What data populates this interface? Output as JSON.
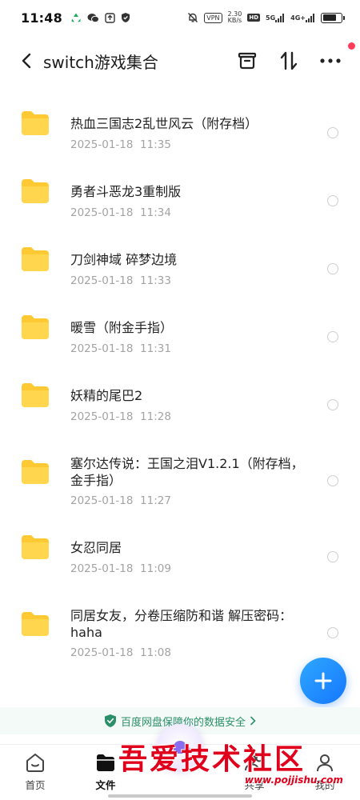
{
  "status_bar": {
    "time": "11:48",
    "vpn": "VPN",
    "speed_value": "2.30",
    "speed_unit": "KB/s",
    "hd": "HD",
    "net_5g": "5G",
    "net_4g": "4G+",
    "battery_level": 0.75
  },
  "header": {
    "title": "switch游戏集合"
  },
  "files": [
    {
      "name": "热血三国志2乱世风云（附存档）",
      "date": "2025-01-18  11:35"
    },
    {
      "name": "勇者斗恶龙3重制版",
      "date": "2025-01-18  11:34"
    },
    {
      "name": "刀剑神域 碎梦边境",
      "date": "2025-01-18  11:33"
    },
    {
      "name": "暖雪（附金手指）",
      "date": "2025-01-18  11:31"
    },
    {
      "name": "妖精的尾巴2",
      "date": "2025-01-18  11:28"
    },
    {
      "name": "塞尔达传说：王国之泪V1.2.1（附存档，金手指）",
      "date": "2025-01-18  11:27"
    },
    {
      "name": "女忍同居",
      "date": "2025-01-18  11:09"
    },
    {
      "name": "同居女友，分卷压缩防和谐 解压密码：haha",
      "date": "2025-01-18  11:08"
    }
  ],
  "security_banner": {
    "text": "百度网盘保障你的数据安全"
  },
  "bottom_nav": {
    "home": "首页",
    "files": "文件",
    "share": "共享",
    "mine": "我的"
  },
  "watermark": {
    "text": "吾爱技术社区",
    "url": "www.pojjishu.com"
  },
  "colors": {
    "accent": "#1677ff",
    "folder": "#ffc933",
    "secure_green": "#2b8f6a",
    "watermark_red": "#e0001b"
  }
}
